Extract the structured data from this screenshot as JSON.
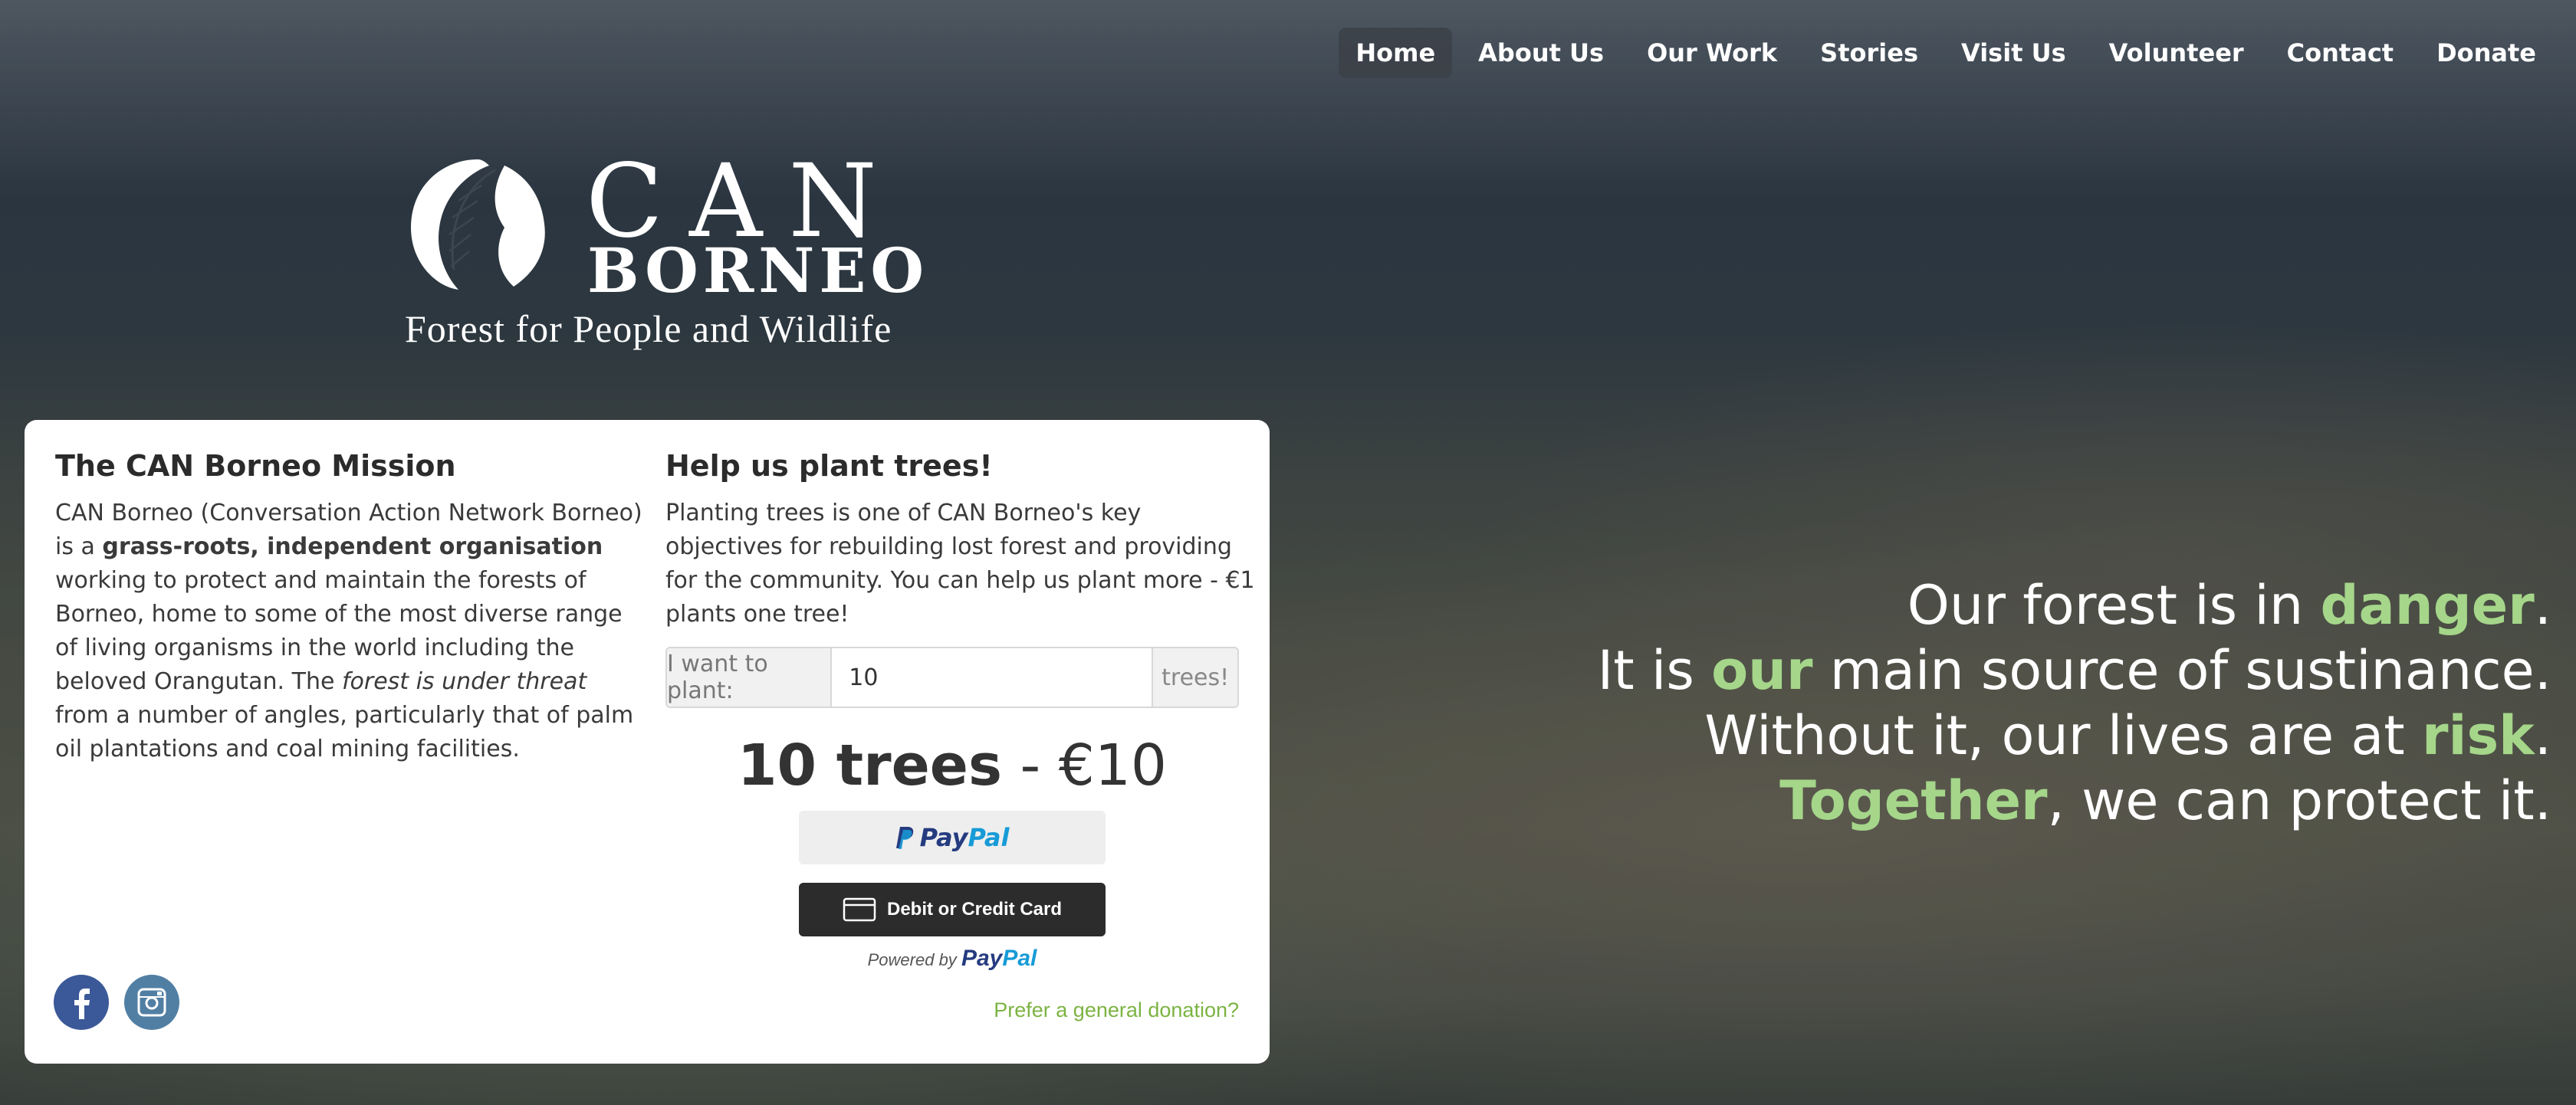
{
  "nav": {
    "items": [
      "Home",
      "About Us",
      "Our Work",
      "Stories",
      "Visit Us",
      "Volunteer",
      "Contact",
      "Donate"
    ],
    "active": "Home"
  },
  "logo": {
    "word1": "CAN",
    "word2": "BORNEO",
    "tagline": "Forest for People and Wildlife"
  },
  "mission": {
    "title": "The CAN Borneo Mission",
    "text_1": "CAN Borneo (Conversation Action Network Borneo) is a ",
    "bold": "grass-roots, independent organisation",
    "text_2": " working to protect and maintain the forests of Borneo, home to some of the most diverse range of living organisms in the world including the beloved Orangutan. The ",
    "italic": "forest is under threat",
    "text_3": " from a number of angles, particularly that of palm oil plantations and coal mining facilities."
  },
  "plant": {
    "title": "Help us plant trees!",
    "text": "Planting trees is one of CAN Borneo's key objectives for rebuilding lost forest and providing for the community. You can help us plant more - €1 plants one tree!",
    "input_label": "I want to plant:",
    "input_value": "10",
    "input_suffix": "trees!",
    "total_trees": "10 trees",
    "total_sep": " - ",
    "total_price": "€10",
    "paypal_pay": "Pay",
    "paypal_pal": "Pal",
    "card_button": "Debit or Credit Card",
    "powered_by": "Powered by",
    "powered_brand_1": "Pay",
    "powered_brand_2": "Pal",
    "general_link": "Prefer a general donation?"
  },
  "slogans": {
    "l1_a": "Our forest is in ",
    "l1_hl": "danger",
    "l1_b": ".",
    "l2_a": "It is ",
    "l2_hl": "our",
    "l2_b": " main source of sustinance.",
    "l3_a": "Without it, our lives are at ",
    "l3_hl": "risk",
    "l3_b": ".",
    "l4_hl": "Together",
    "l4_b": ", we can protect it."
  },
  "colors": {
    "accent_green": "#a5d68a",
    "link_green": "#7cb342",
    "paypal_dark": "#253b80",
    "paypal_light": "#179bd7",
    "facebook": "#3b5998",
    "instagram": "#517fa4"
  },
  "icons": [
    "leaf-logo-icon",
    "paypal-p-icon",
    "credit-card-icon",
    "facebook-icon",
    "instagram-icon"
  ]
}
